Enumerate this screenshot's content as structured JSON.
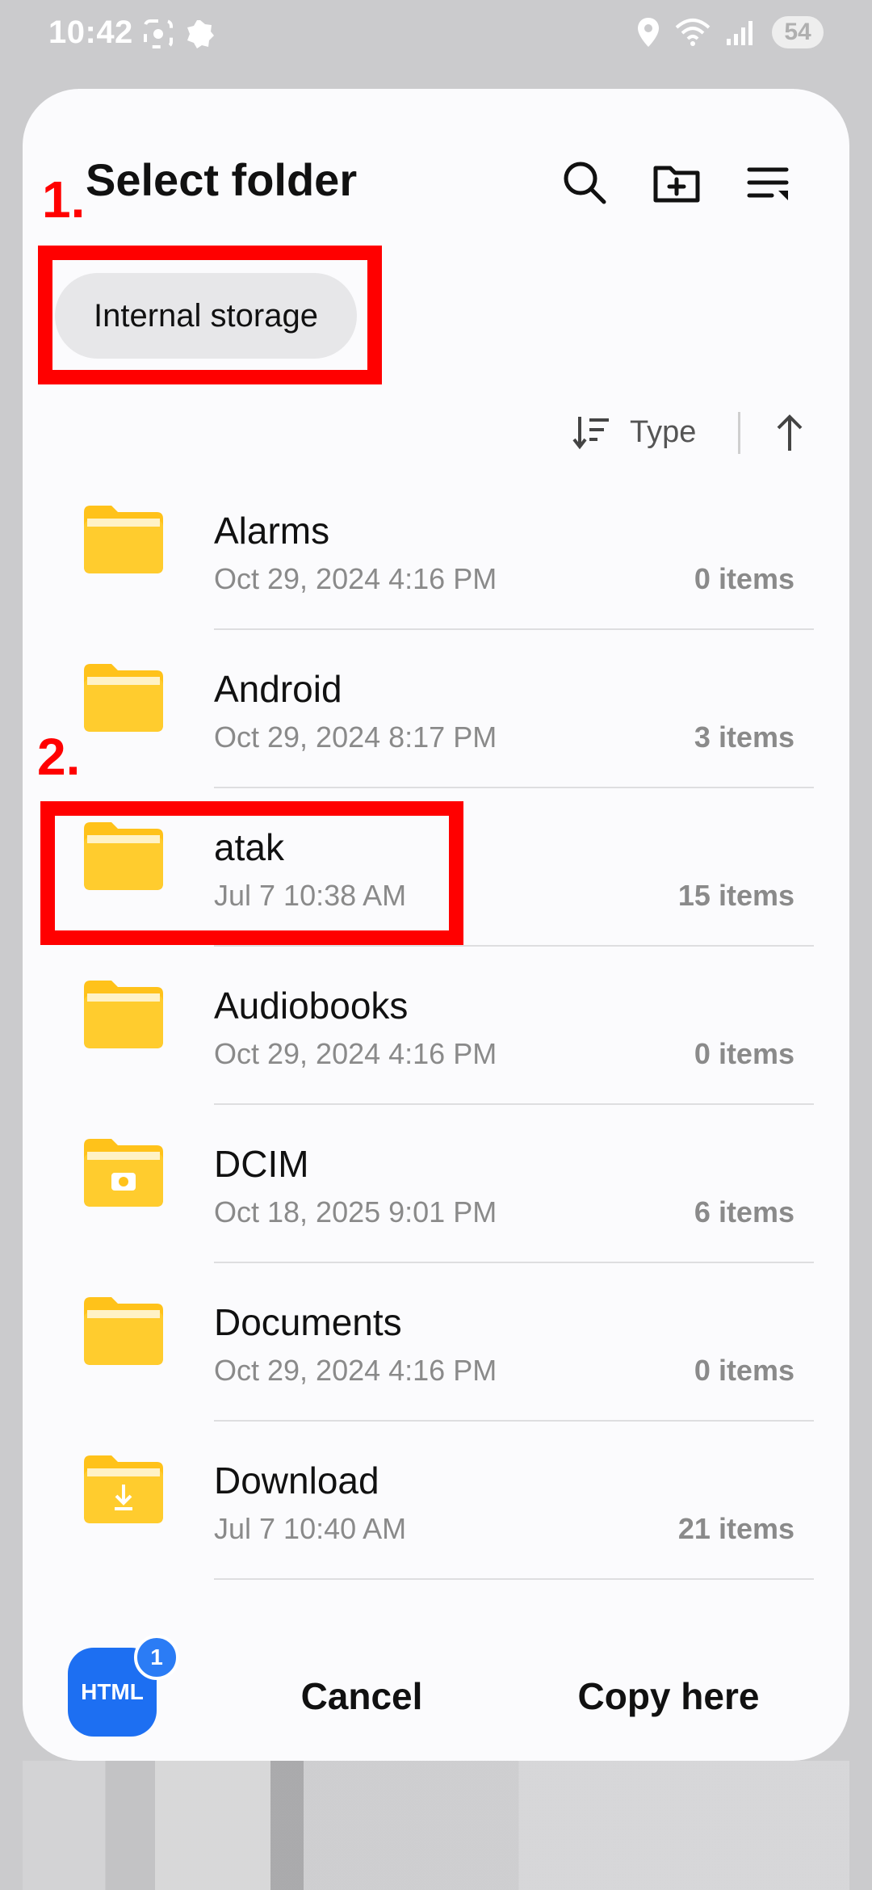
{
  "status_bar": {
    "time": "10:42",
    "battery": "54"
  },
  "dialog": {
    "title": "Select folder",
    "icons": [
      "search-icon",
      "new-folder-icon",
      "list-options-icon"
    ],
    "storage_chip": "Internal storage",
    "sort": {
      "label": "Type"
    }
  },
  "folders": [
    {
      "name": "Alarms",
      "date": "Oct 29, 2024 4:16 PM",
      "count": "0 items",
      "icon": "folder-icon"
    },
    {
      "name": "Android",
      "date": "Oct 29, 2024 8:17 PM",
      "count": "3 items",
      "icon": "folder-icon"
    },
    {
      "name": "atak",
      "date": "Jul 7 10:38 AM",
      "count": "15 items",
      "icon": "folder-icon"
    },
    {
      "name": "Audiobooks",
      "date": "Oct 29, 2024 4:16 PM",
      "count": "0 items",
      "icon": "folder-icon"
    },
    {
      "name": "DCIM",
      "date": "Oct 18, 2025 9:01 PM",
      "count": "6 items",
      "icon": "camera-folder-icon"
    },
    {
      "name": "Documents",
      "date": "Oct 29, 2024 4:16 PM",
      "count": "0 items",
      "icon": "folder-icon"
    },
    {
      "name": "Download",
      "date": "Jul 7 10:40 AM",
      "count": "21 items",
      "icon": "download-folder-icon"
    }
  ],
  "bottom": {
    "app_label": "HTML",
    "badge": "1",
    "cancel": "Cancel",
    "copy": "Copy here"
  },
  "annotations": {
    "label_1": "1.",
    "label_2": "2."
  },
  "colors": {
    "accent_annotation": "#ff0000",
    "folder_yellow": "#ffc21a",
    "html_app_blue": "#1d6ff2"
  }
}
